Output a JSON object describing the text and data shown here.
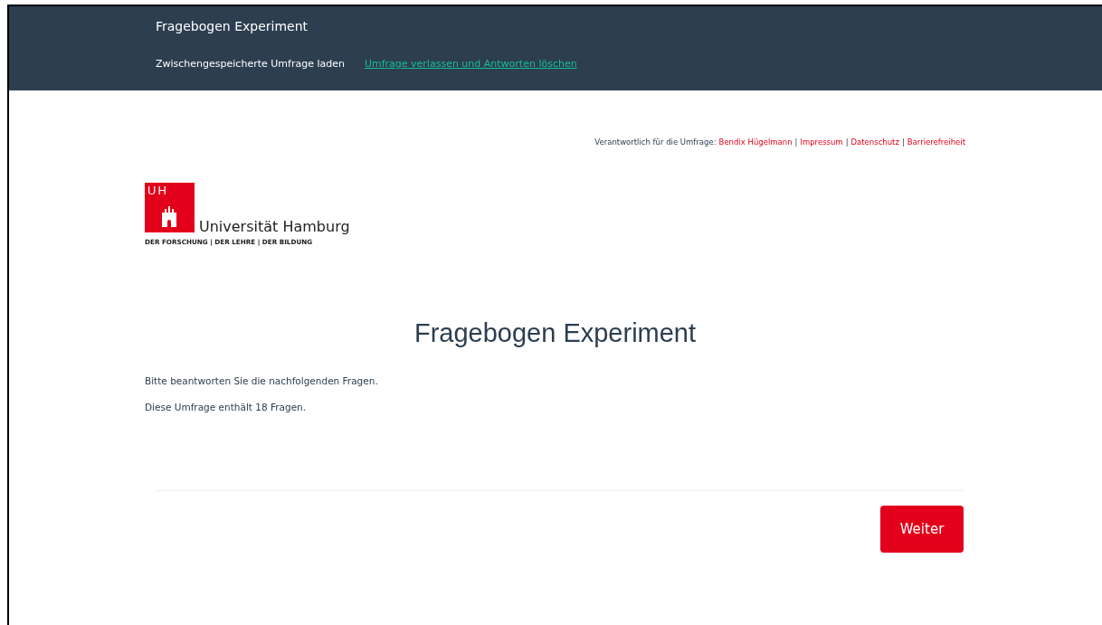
{
  "navbar": {
    "title": "Fragebogen Experiment",
    "links": [
      {
        "label": "Zwischengespeicherte Umfrage laden",
        "kind": "plain"
      },
      {
        "label": "Umfrage verlassen und Antworten löschen",
        "kind": "accent"
      }
    ]
  },
  "responsible": {
    "label": "Verantwortlich für die Umfrage:",
    "links": [
      "Bendix Hügelmann",
      "Impressum",
      "Datenschutz",
      "Barrierefreiheit"
    ],
    "separators": [
      "|",
      "|",
      "|"
    ]
  },
  "logo": {
    "mark": "UH",
    "name": "Universität Hamburg",
    "tagline": "DER FORSCHUNG | DER LEHRE | DER BILDUNG"
  },
  "survey": {
    "title": "Fragebogen Experiment",
    "paragraphs": [
      "Bitte beantworten Sie die nachfolgenden Fragen.",
      "Diese Umfrage enthält 18 Fragen."
    ]
  },
  "buttons": [
    "Weiter"
  ]
}
